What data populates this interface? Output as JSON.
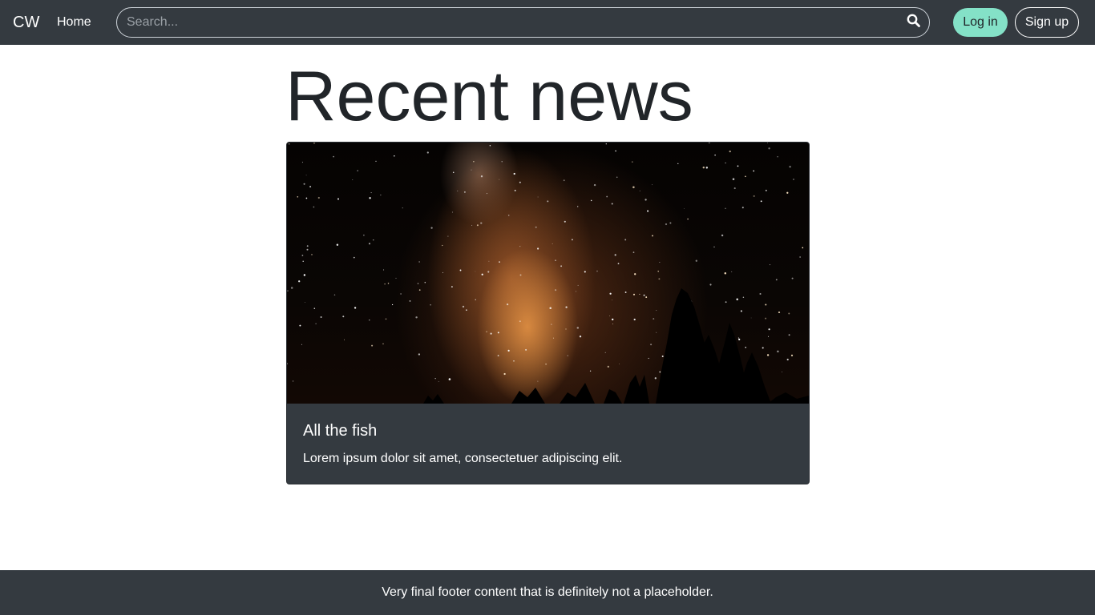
{
  "navbar": {
    "brand": "CW",
    "home_label": "Home",
    "search_placeholder": "Search...",
    "search_icon": "search-icon",
    "login_label": "Log in",
    "signup_label": "Sign up",
    "login_color": "#84e1c7",
    "background": "#343a40"
  },
  "main": {
    "title": "Recent news",
    "cards": [
      {
        "image": "milky-way-night-sky-with-tree-silhouettes",
        "title": "All the fish",
        "text": "Lorem ipsum dolor sit amet, consectetuer adipiscing elit."
      }
    ]
  },
  "footer": {
    "text": "Very final footer content that is definitely not a placeholder."
  }
}
